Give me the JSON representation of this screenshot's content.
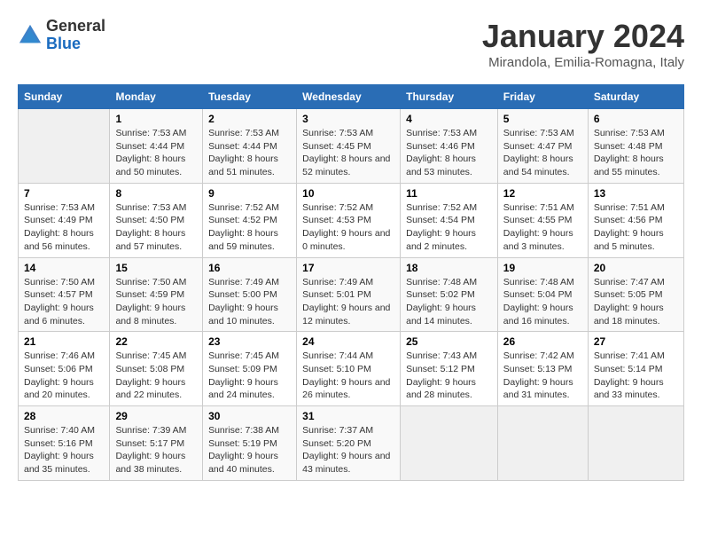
{
  "header": {
    "logo_general": "General",
    "logo_blue": "Blue",
    "month_title": "January 2024",
    "location": "Mirandola, Emilia-Romagna, Italy"
  },
  "days_of_week": [
    "Sunday",
    "Monday",
    "Tuesday",
    "Wednesday",
    "Thursday",
    "Friday",
    "Saturday"
  ],
  "weeks": [
    [
      {
        "day": "",
        "sunrise": "",
        "sunset": "",
        "daylight": ""
      },
      {
        "day": "1",
        "sunrise": "Sunrise: 7:53 AM",
        "sunset": "Sunset: 4:44 PM",
        "daylight": "Daylight: 8 hours and 50 minutes."
      },
      {
        "day": "2",
        "sunrise": "Sunrise: 7:53 AM",
        "sunset": "Sunset: 4:44 PM",
        "daylight": "Daylight: 8 hours and 51 minutes."
      },
      {
        "day": "3",
        "sunrise": "Sunrise: 7:53 AM",
        "sunset": "Sunset: 4:45 PM",
        "daylight": "Daylight: 8 hours and 52 minutes."
      },
      {
        "day": "4",
        "sunrise": "Sunrise: 7:53 AM",
        "sunset": "Sunset: 4:46 PM",
        "daylight": "Daylight: 8 hours and 53 minutes."
      },
      {
        "day": "5",
        "sunrise": "Sunrise: 7:53 AM",
        "sunset": "Sunset: 4:47 PM",
        "daylight": "Daylight: 8 hours and 54 minutes."
      },
      {
        "day": "6",
        "sunrise": "Sunrise: 7:53 AM",
        "sunset": "Sunset: 4:48 PM",
        "daylight": "Daylight: 8 hours and 55 minutes."
      }
    ],
    [
      {
        "day": "7",
        "sunrise": "Sunrise: 7:53 AM",
        "sunset": "Sunset: 4:49 PM",
        "daylight": "Daylight: 8 hours and 56 minutes."
      },
      {
        "day": "8",
        "sunrise": "Sunrise: 7:53 AM",
        "sunset": "Sunset: 4:50 PM",
        "daylight": "Daylight: 8 hours and 57 minutes."
      },
      {
        "day": "9",
        "sunrise": "Sunrise: 7:52 AM",
        "sunset": "Sunset: 4:52 PM",
        "daylight": "Daylight: 8 hours and 59 minutes."
      },
      {
        "day": "10",
        "sunrise": "Sunrise: 7:52 AM",
        "sunset": "Sunset: 4:53 PM",
        "daylight": "Daylight: 9 hours and 0 minutes."
      },
      {
        "day": "11",
        "sunrise": "Sunrise: 7:52 AM",
        "sunset": "Sunset: 4:54 PM",
        "daylight": "Daylight: 9 hours and 2 minutes."
      },
      {
        "day": "12",
        "sunrise": "Sunrise: 7:51 AM",
        "sunset": "Sunset: 4:55 PM",
        "daylight": "Daylight: 9 hours and 3 minutes."
      },
      {
        "day": "13",
        "sunrise": "Sunrise: 7:51 AM",
        "sunset": "Sunset: 4:56 PM",
        "daylight": "Daylight: 9 hours and 5 minutes."
      }
    ],
    [
      {
        "day": "14",
        "sunrise": "Sunrise: 7:50 AM",
        "sunset": "Sunset: 4:57 PM",
        "daylight": "Daylight: 9 hours and 6 minutes."
      },
      {
        "day": "15",
        "sunrise": "Sunrise: 7:50 AM",
        "sunset": "Sunset: 4:59 PM",
        "daylight": "Daylight: 9 hours and 8 minutes."
      },
      {
        "day": "16",
        "sunrise": "Sunrise: 7:49 AM",
        "sunset": "Sunset: 5:00 PM",
        "daylight": "Daylight: 9 hours and 10 minutes."
      },
      {
        "day": "17",
        "sunrise": "Sunrise: 7:49 AM",
        "sunset": "Sunset: 5:01 PM",
        "daylight": "Daylight: 9 hours and 12 minutes."
      },
      {
        "day": "18",
        "sunrise": "Sunrise: 7:48 AM",
        "sunset": "Sunset: 5:02 PM",
        "daylight": "Daylight: 9 hours and 14 minutes."
      },
      {
        "day": "19",
        "sunrise": "Sunrise: 7:48 AM",
        "sunset": "Sunset: 5:04 PM",
        "daylight": "Daylight: 9 hours and 16 minutes."
      },
      {
        "day": "20",
        "sunrise": "Sunrise: 7:47 AM",
        "sunset": "Sunset: 5:05 PM",
        "daylight": "Daylight: 9 hours and 18 minutes."
      }
    ],
    [
      {
        "day": "21",
        "sunrise": "Sunrise: 7:46 AM",
        "sunset": "Sunset: 5:06 PM",
        "daylight": "Daylight: 9 hours and 20 minutes."
      },
      {
        "day": "22",
        "sunrise": "Sunrise: 7:45 AM",
        "sunset": "Sunset: 5:08 PM",
        "daylight": "Daylight: 9 hours and 22 minutes."
      },
      {
        "day": "23",
        "sunrise": "Sunrise: 7:45 AM",
        "sunset": "Sunset: 5:09 PM",
        "daylight": "Daylight: 9 hours and 24 minutes."
      },
      {
        "day": "24",
        "sunrise": "Sunrise: 7:44 AM",
        "sunset": "Sunset: 5:10 PM",
        "daylight": "Daylight: 9 hours and 26 minutes."
      },
      {
        "day": "25",
        "sunrise": "Sunrise: 7:43 AM",
        "sunset": "Sunset: 5:12 PM",
        "daylight": "Daylight: 9 hours and 28 minutes."
      },
      {
        "day": "26",
        "sunrise": "Sunrise: 7:42 AM",
        "sunset": "Sunset: 5:13 PM",
        "daylight": "Daylight: 9 hours and 31 minutes."
      },
      {
        "day": "27",
        "sunrise": "Sunrise: 7:41 AM",
        "sunset": "Sunset: 5:14 PM",
        "daylight": "Daylight: 9 hours and 33 minutes."
      }
    ],
    [
      {
        "day": "28",
        "sunrise": "Sunrise: 7:40 AM",
        "sunset": "Sunset: 5:16 PM",
        "daylight": "Daylight: 9 hours and 35 minutes."
      },
      {
        "day": "29",
        "sunrise": "Sunrise: 7:39 AM",
        "sunset": "Sunset: 5:17 PM",
        "daylight": "Daylight: 9 hours and 38 minutes."
      },
      {
        "day": "30",
        "sunrise": "Sunrise: 7:38 AM",
        "sunset": "Sunset: 5:19 PM",
        "daylight": "Daylight: 9 hours and 40 minutes."
      },
      {
        "day": "31",
        "sunrise": "Sunrise: 7:37 AM",
        "sunset": "Sunset: 5:20 PM",
        "daylight": "Daylight: 9 hours and 43 minutes."
      },
      {
        "day": "",
        "sunrise": "",
        "sunset": "",
        "daylight": ""
      },
      {
        "day": "",
        "sunrise": "",
        "sunset": "",
        "daylight": ""
      },
      {
        "day": "",
        "sunrise": "",
        "sunset": "",
        "daylight": ""
      }
    ]
  ]
}
